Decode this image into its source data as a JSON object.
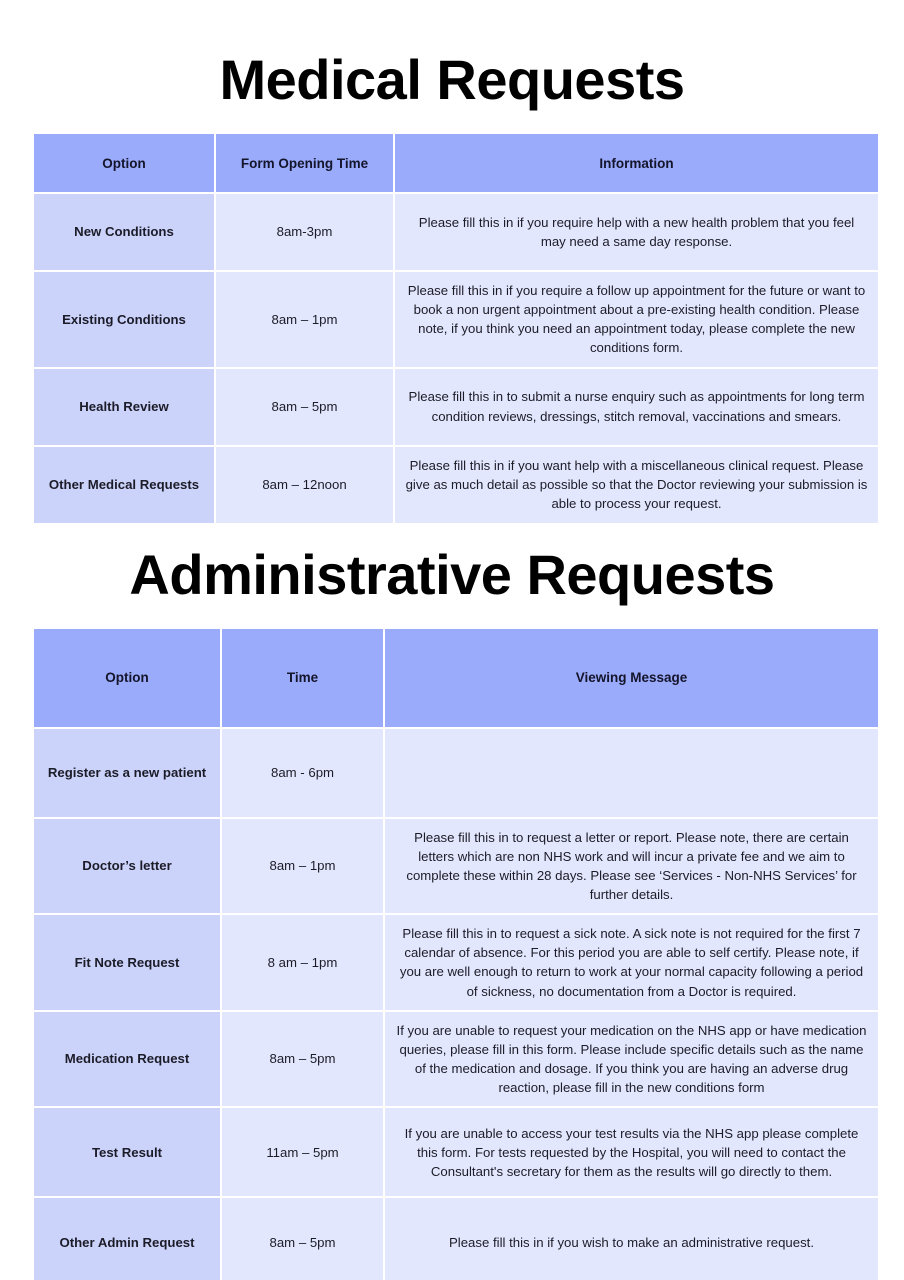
{
  "colors": {
    "header_blue": "#9aabfb",
    "option_cell": "#ccd3fb",
    "body_cell": "#e3e7fd",
    "page_background": "#ffffff",
    "text": "#1c1c28",
    "title_text": "#000000"
  },
  "medical": {
    "title": "Medical Requests",
    "columns": [
      "Option",
      "Form Opening Time",
      "Information"
    ],
    "rows": [
      {
        "option": "New Conditions",
        "time": "8am-3pm",
        "information": "Please fill this in if you require help with a new health problem that you feel may need a same day response."
      },
      {
        "option": "Existing Conditions",
        "time": "8am – 1pm",
        "information": "Please fill this in if you require a follow up appointment for the future or want to book a non urgent appointment about a pre-existing health condition.   Please note, if you think you need an appointment today, please complete the new conditions form."
      },
      {
        "option": "Health Review",
        "time": "8am – 5pm",
        "information": "Please fill this in to submit a nurse enquiry such as appointments for long term condition reviews, dressings, stitch removal, vaccinations and smears."
      },
      {
        "option": "Other Medical Requests",
        "time": "8am – 12noon",
        "information": "Please fill this in if you want help with a miscellaneous clinical request. Please give as much detail as possible so that the Doctor reviewing your submission is able to process your request."
      }
    ]
  },
  "administrative": {
    "title": "Administrative Requests",
    "columns": [
      "Option",
      "Time",
      "Viewing Message"
    ],
    "rows": [
      {
        "option": "Register as a new patient",
        "time": "8am - 6pm",
        "information": ""
      },
      {
        "option": "Doctor’s letter",
        "time": "8am – 1pm",
        "information": "Please fill this in to request a letter or report. Please note, there are certain letters which are non NHS work and will incur a private fee and we aim to complete these within 28 days. Please see ‘Services - Non-NHS Services’ for further details."
      },
      {
        "option": "Fit Note Request",
        "time": "8 am – 1pm",
        "information": "Please fill this in to request a sick note. A sick note is not required for the first 7 calendar of absence. For this period you are able to self certify.  Please note, if you are well enough to return to work at your normal capacity following a period of sickness, no documentation from a Doctor is required."
      },
      {
        "option": "Medication Request",
        "time": "8am – 5pm",
        "information": "If you are unable to request your medication on the NHS app or have medication queries, please fill in this form. Please include specific details such as the name of the medication and dosage. If you think you are having an adverse drug reaction, please fill in the new conditions form"
      },
      {
        "option": "Test Result",
        "time": "11am – 5pm",
        "information": "If you are unable to access your test results via the NHS app please complete this form. For tests requested by the Hospital, you will need to contact the Consultant's secretary for them as the results will go directly to them."
      },
      {
        "option": "Other Admin Request",
        "time": "8am – 5pm",
        "information": "Please fill this in if you wish to make an administrative request."
      }
    ]
  }
}
